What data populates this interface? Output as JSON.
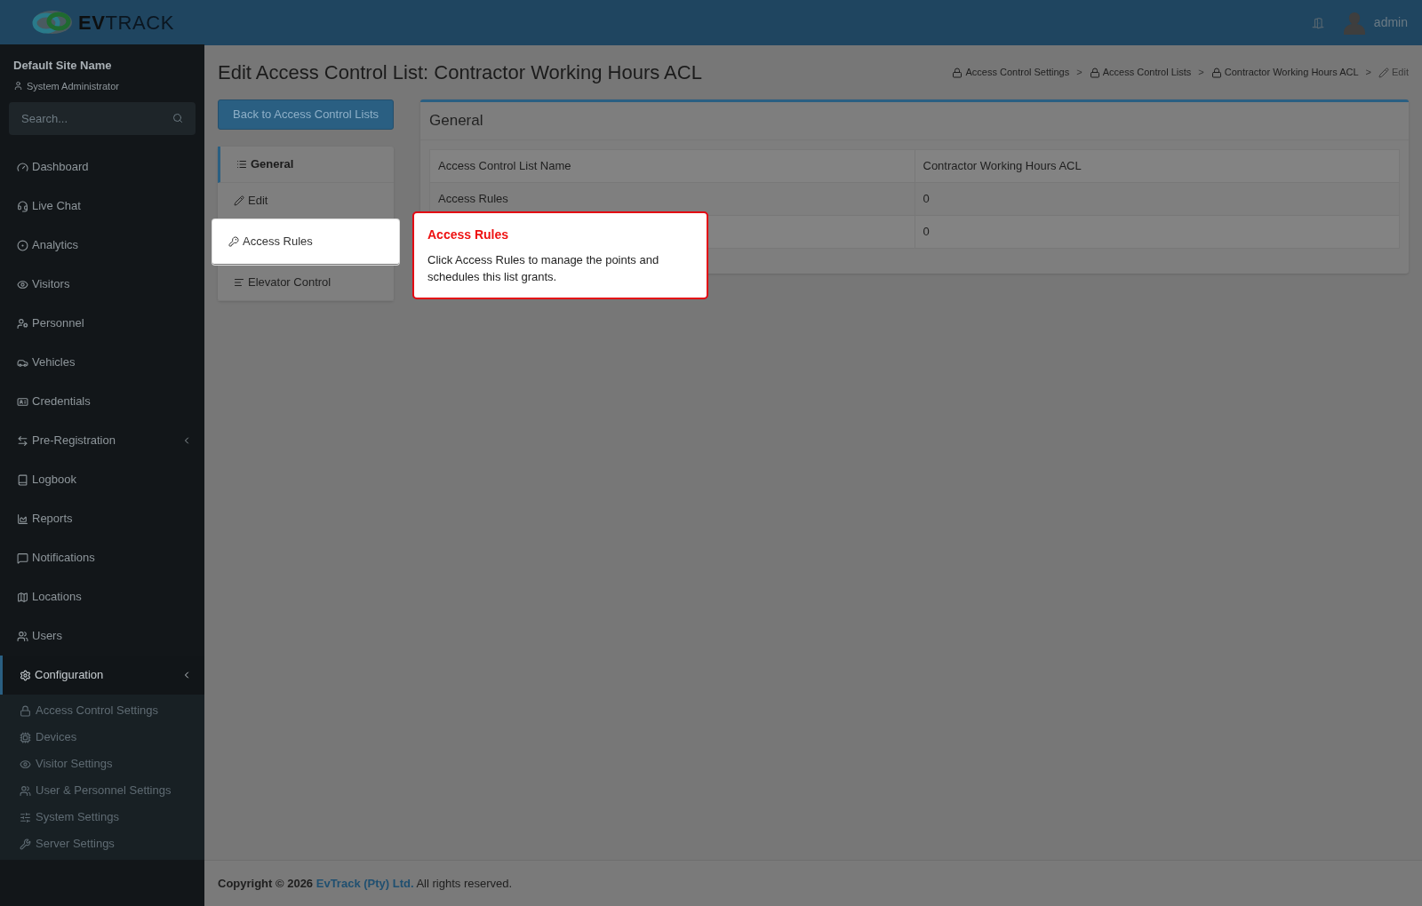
{
  "header": {
    "brand_bold": "EV",
    "brand_light": "TRACK",
    "user": "admin"
  },
  "sidebar": {
    "site": "Default Site Name",
    "role": "System Administrator",
    "search": {
      "placeholder": "Search..."
    },
    "items": [
      {
        "label": "Dashboard",
        "active": false,
        "has_caret": false
      },
      {
        "label": "Live Chat",
        "active": false,
        "has_caret": false
      },
      {
        "label": "Analytics",
        "active": false,
        "has_caret": false
      },
      {
        "label": "Visitors",
        "active": false,
        "has_caret": false
      },
      {
        "label": "Personnel",
        "active": false,
        "has_caret": false
      },
      {
        "label": "Vehicles",
        "active": false,
        "has_caret": false
      },
      {
        "label": "Credentials",
        "active": false,
        "has_caret": false
      },
      {
        "label": "Pre-Registration",
        "active": false,
        "has_caret": true
      },
      {
        "label": "Logbook",
        "active": false,
        "has_caret": false
      },
      {
        "label": "Reports",
        "active": false,
        "has_caret": false
      },
      {
        "label": "Notifications",
        "active": false,
        "has_caret": false
      },
      {
        "label": "Locations",
        "active": false,
        "has_caret": false
      },
      {
        "label": "Users",
        "active": false,
        "has_caret": false
      },
      {
        "label": "Configuration",
        "active": true,
        "has_caret": true,
        "children": [
          {
            "label": "Access Control Settings"
          },
          {
            "label": "Devices"
          },
          {
            "label": "Visitor Settings"
          },
          {
            "label": "User & Personnel Settings"
          },
          {
            "label": "System Settings"
          },
          {
            "label": "Server Settings"
          }
        ]
      }
    ]
  },
  "page": {
    "title": "Edit Access Control List: Contractor Working Hours ACL",
    "breadcrumbs": [
      {
        "label": "Access Control Settings",
        "separator": ">"
      },
      {
        "label": "Access Control Lists",
        "separator": ">"
      },
      {
        "label": "Contractor Working Hours ACL",
        "separator": ">"
      },
      {
        "label": "Edit"
      }
    ],
    "back_button": "Back to Access Control Lists",
    "tabs": [
      {
        "label": "General",
        "selected": true,
        "spotlight": false
      },
      {
        "label": "Edit",
        "selected": false,
        "spotlight": false
      },
      {
        "label": "Access Rules",
        "selected": false,
        "spotlight": true
      },
      {
        "label": "Elevator Control",
        "selected": false,
        "spotlight": false
      }
    ],
    "card": {
      "title": "General",
      "rows": [
        {
          "column_1": "Access Control List Name",
          "column_2": "Contractor Working Hours ACL"
        },
        {
          "column_1": "Access Rules",
          "column_2": "0"
        },
        {
          "column_2": "0"
        }
      ]
    }
  },
  "tour": {
    "title": "Access Rules",
    "text": "Click Access Rules to manage the points and schedules this list grants."
  },
  "footer": {
    "prefix": "Copyright © 2026",
    "company": "EvTrack (Pty) Ltd.",
    "suffix": "All rights reserved."
  }
}
